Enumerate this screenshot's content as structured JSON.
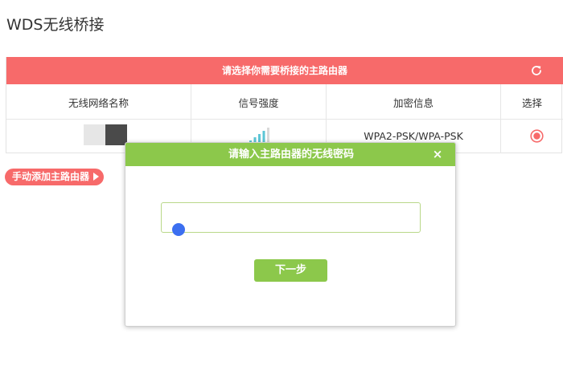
{
  "page": {
    "title": "WDS无线桥接"
  },
  "scan_panel": {
    "header": "请选择你需要桥接的主路由器",
    "columns": [
      "无线网络名称",
      "信号强度",
      "加密信息",
      "选择"
    ],
    "rows": [
      {
        "ssid": "",
        "signal_bars": 4,
        "encryption": "WPA2-PSK/WPA-PSK",
        "selected": true
      }
    ]
  },
  "manual_add": {
    "label": "手动添加主路由器"
  },
  "dialog": {
    "title": "请输入主路由器的无线密码",
    "password": {
      "value": "",
      "placeholder": ""
    },
    "next_label": "下一步"
  },
  "colors": {
    "accent_red": "#f76a6a",
    "accent_green": "#8cc84b",
    "signal": "#5cc6d6",
    "touch_dot": "#3c6ff0"
  },
  "icons": {
    "refresh": "refresh-icon",
    "close": "close-icon",
    "signal": "signal-strength-icon",
    "radio": "radio-selected-icon",
    "arrow": "arrow-right-icon"
  }
}
